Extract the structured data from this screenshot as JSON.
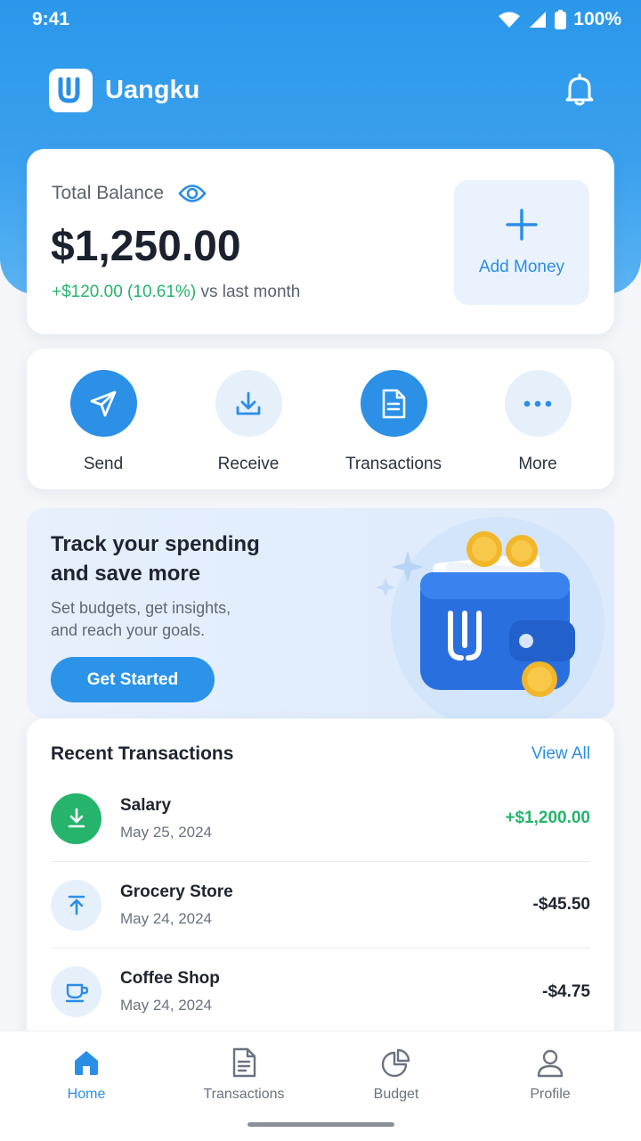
{
  "status_bar": {
    "time": "9:41",
    "battery": "100%",
    "icons": [
      "wifi-icon",
      "signal-icon",
      "battery-icon"
    ]
  },
  "header": {
    "logo_icon": "uangku-logo",
    "app_name": "Uangku",
    "notification_icon": "bell-icon"
  },
  "balance": {
    "label": "Total Balance",
    "visibility_icon": "eye-icon",
    "amount": "$1,250.00",
    "delta": "+$120.00 (10.61%)",
    "delta_suffix": "vs last month",
    "add_money_label": "Add Money"
  },
  "actions": [
    {
      "label": "Send",
      "icon": "send-icon"
    },
    {
      "label": "Receive",
      "icon": "download-icon"
    },
    {
      "label": "Transactions",
      "icon": "document-icon"
    },
    {
      "label": "More",
      "icon": "more-icon"
    }
  ],
  "promo": {
    "title_line1": "Track your spending",
    "title_line2": "and save more",
    "subtitle_line1": "Set budgets, get insights,",
    "subtitle_line2": "and reach your goals.",
    "button_label": "Get Started",
    "illustration": "wallet-with-coins-illustration"
  },
  "recent_transactions": {
    "title": "Recent Transactions",
    "view_all": "View All",
    "items": [
      {
        "name": "Salary",
        "date": "May 25, 2024",
        "amount": "+$1,200.00",
        "icon": "download-icon",
        "type": "income"
      },
      {
        "name": "Grocery Store",
        "date": "May 24, 2024",
        "amount": "-$45.50",
        "icon": "upload-icon",
        "type": "expense"
      },
      {
        "name": "Coffee Shop",
        "date": "May 24, 2024",
        "amount": "-$4.75",
        "icon": "coffee-icon",
        "type": "expense"
      }
    ]
  },
  "bottom_nav": {
    "active": "Home",
    "items": [
      {
        "label": "Home",
        "icon": "home-icon"
      },
      {
        "label": "Transactions",
        "icon": "document-icon"
      },
      {
        "label": "Budget",
        "icon": "pie-chart-icon"
      },
      {
        "label": "Profile",
        "icon": "user-icon"
      }
    ]
  },
  "colors": {
    "primary": "#2b8ee6",
    "positive": "#24b56a",
    "background": "#f4f6f9"
  }
}
